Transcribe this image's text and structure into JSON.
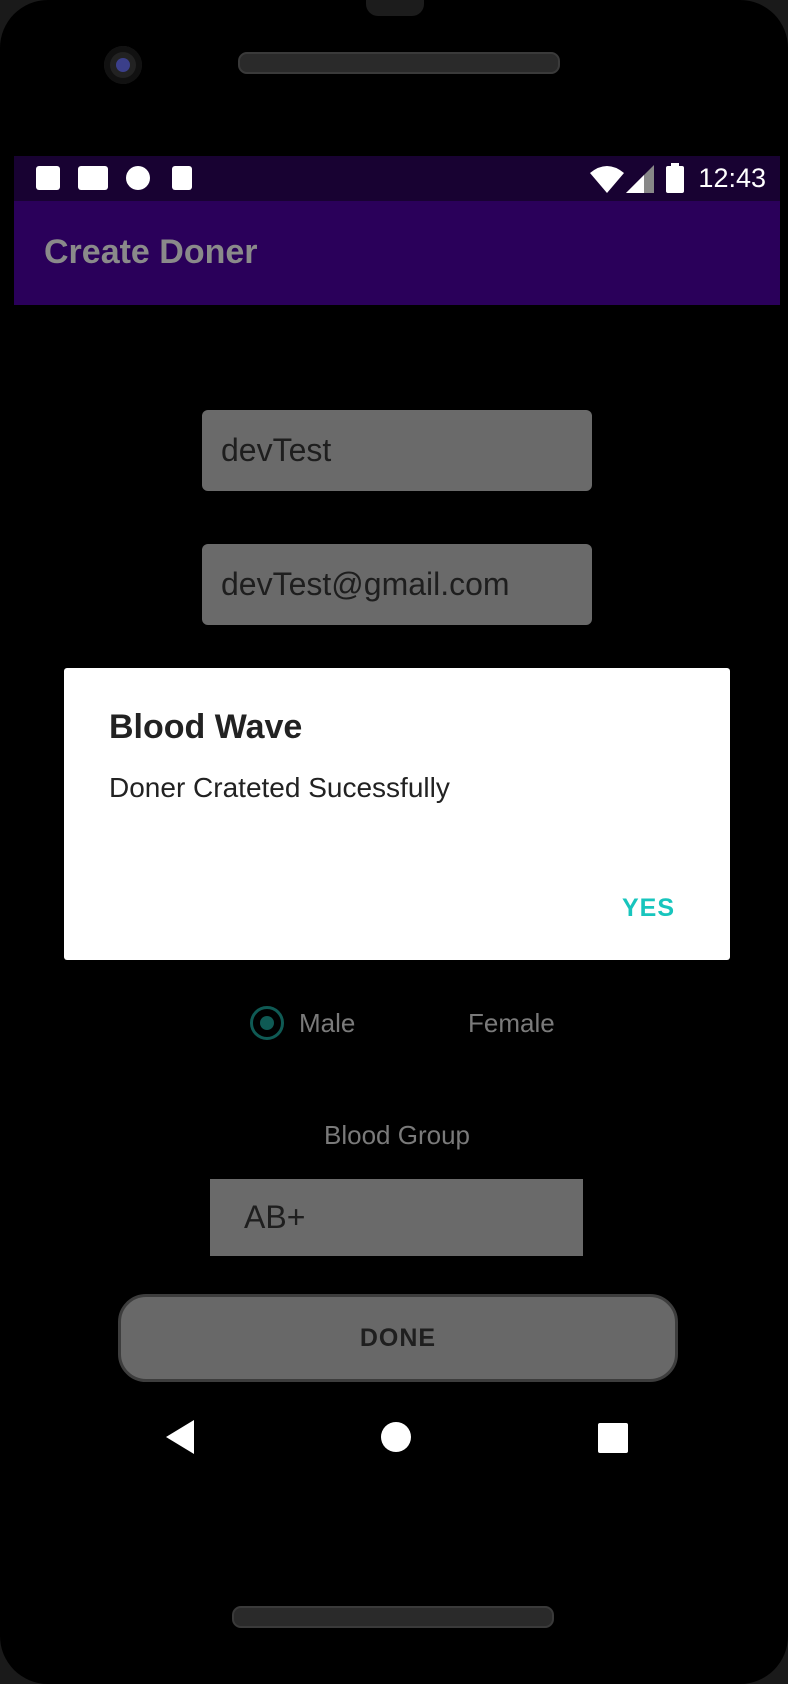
{
  "status_bar": {
    "time": "12:43",
    "left_icons": [
      "notes-icon",
      "gmail-icon",
      "record-icon",
      "sd-card-icon"
    ],
    "right_icons": [
      "wifi-icon",
      "signal-icon",
      "battery-icon"
    ]
  },
  "toolbar": {
    "title": "Create Doner"
  },
  "form": {
    "name_value": "devTest",
    "email_value": "devTest@gmail.com",
    "gender": {
      "options": [
        "Male",
        "Female"
      ],
      "selected": "Male"
    },
    "blood_group_label": "Blood Group",
    "blood_group_value": "AB+",
    "done_label": "DONE"
  },
  "dialog": {
    "title": "Blood Wave",
    "message": "Doner Crateted Sucessfully",
    "confirm_label": "YES"
  },
  "nav_bar": {
    "buttons": [
      "back-icon",
      "home-icon",
      "recents-icon"
    ]
  },
  "colors": {
    "status_bar": "#180232",
    "toolbar": "#2a005a",
    "accent": "#18c5bd",
    "radio": "#0f5a54"
  }
}
